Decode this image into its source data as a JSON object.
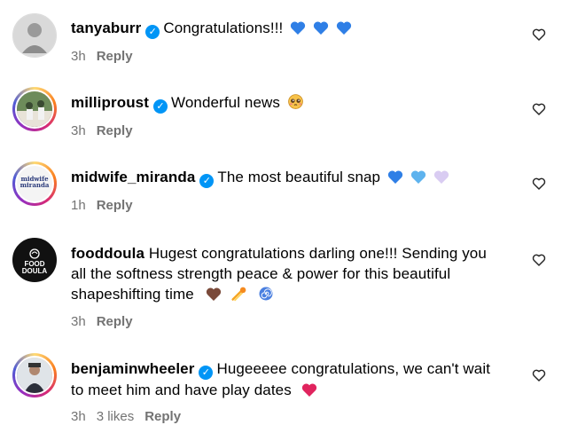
{
  "comments": [
    {
      "username": "tanyaburr",
      "verified": true,
      "text": "Congratulations!!!",
      "emojis": [
        "blue-heart",
        "blue-heart",
        "blue-heart"
      ],
      "time": "3h",
      "likes": "",
      "reply_label": "Reply"
    },
    {
      "username": "milliproust",
      "verified": true,
      "text": "Wonderful news",
      "emojis": [
        "pleading-face"
      ],
      "time": "3h",
      "likes": "",
      "reply_label": "Reply"
    },
    {
      "username": "midwife_miranda",
      "verified": true,
      "text": "The most beautiful snap",
      "emojis": [
        "blue-heart",
        "light-blue-heart",
        "light-purple-heart"
      ],
      "time": "1h",
      "likes": "",
      "reply_label": "Reply",
      "avatar_text": [
        "midwife",
        "miranda"
      ]
    },
    {
      "username": "fooddoula",
      "verified": false,
      "text_lines": [
        "Hugest congratulations darling one!!! Sending you",
        "all the softness strength peace & power for this beautiful",
        "shapeshifting time"
      ],
      "emojis": [
        "brown-heart",
        "comet",
        "spiral"
      ],
      "time": "3h",
      "likes": "",
      "reply_label": "Reply",
      "avatar_text": [
        "FOOD",
        "DOULA"
      ]
    },
    {
      "username": "benjaminwheeler",
      "verified": true,
      "text_lines": [
        "Hugeeeee congratulations, we can't wait",
        "to meet him and have play dates"
      ],
      "emojis": [
        "heart"
      ],
      "time": "3h",
      "likes": "3 likes",
      "reply_label": "Reply"
    }
  ],
  "colors": {
    "verified": "#0095f6",
    "muted": "#737373",
    "blue_heart": "#2f7fe6",
    "light_blue_heart": "#5eb3ee",
    "light_purple_heart": "#d9ccf2",
    "brown_heart": "#7a4a3a",
    "red_heart": "#e0245e"
  }
}
